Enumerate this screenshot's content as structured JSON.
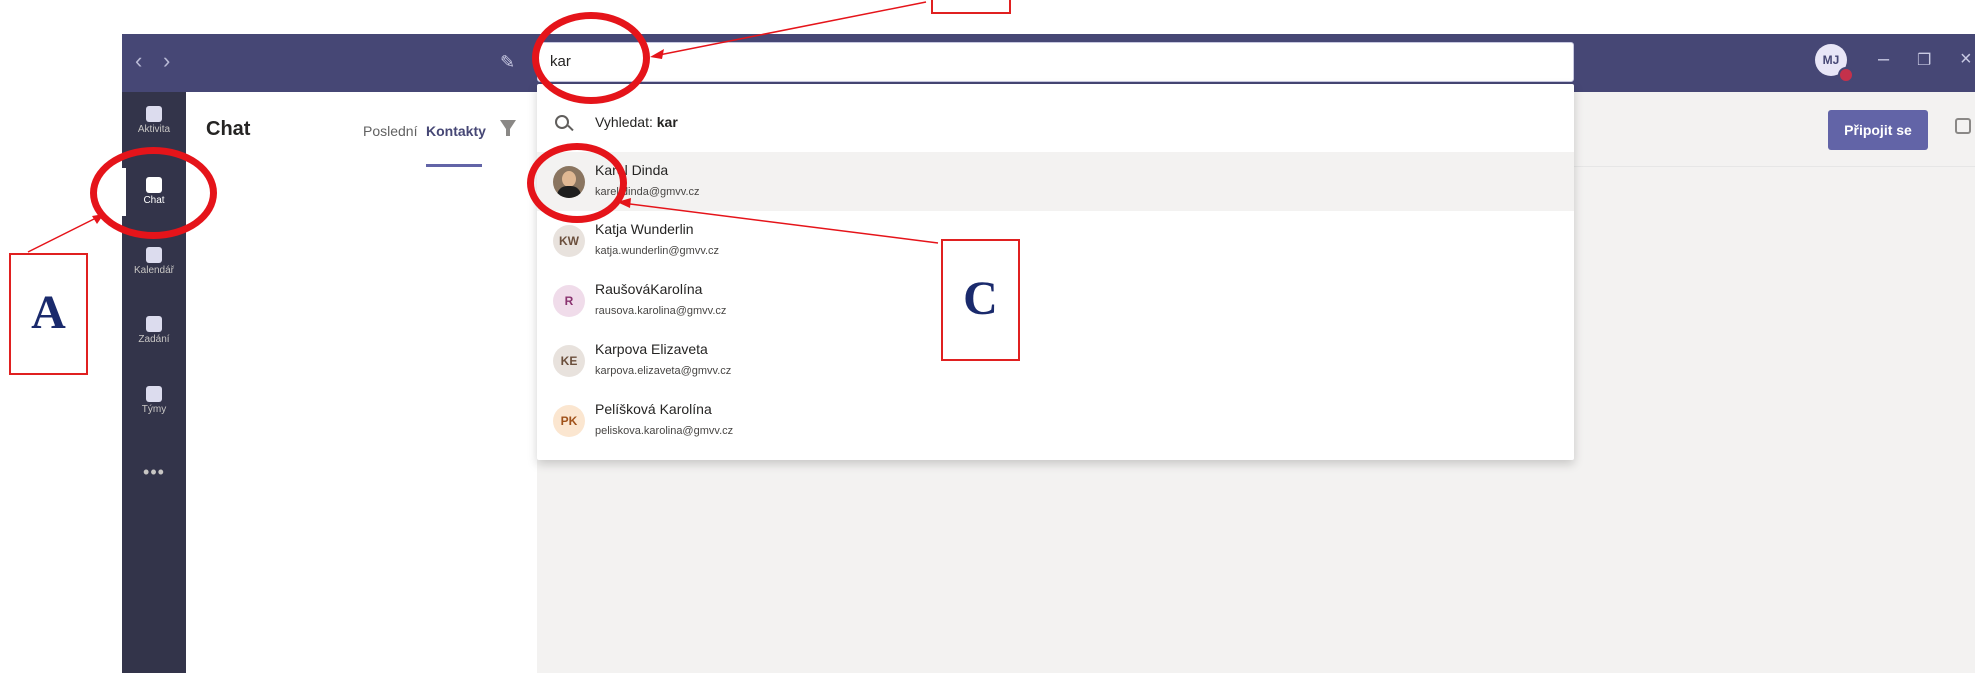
{
  "search": {
    "value": "kar"
  },
  "account": {
    "initials": "MJ"
  },
  "rail": {
    "items": [
      {
        "label": "Aktivita",
        "icon": "bell-icon"
      },
      {
        "label": "Chat",
        "icon": "chat-icon"
      },
      {
        "label": "Kalendář",
        "icon": "calendar-icon"
      },
      {
        "label": "Zadání",
        "icon": "assignments-icon"
      },
      {
        "label": "Týmy",
        "icon": "teams-icon"
      }
    ],
    "more": "•••"
  },
  "listpane": {
    "title": "Chat",
    "tabs": [
      {
        "label": "Poslední"
      },
      {
        "label": "Kontakty"
      }
    ]
  },
  "header": {
    "join_label": "Připojit se"
  },
  "dropdown": {
    "search_prefix": "Vyhledat: ",
    "search_term": "kar",
    "results": [
      {
        "name": "Karel Dinda",
        "email": "karel.dinda@gmvv.cz",
        "initials": "",
        "photo": true,
        "avatar_bg": "#8a7560",
        "avatar_fg": "#ffffff"
      },
      {
        "name": "Katja Wunderlin",
        "email": "katja.wunderlin@gmvv.cz",
        "initials": "KW",
        "avatar_bg": "#e8e2dd",
        "avatar_fg": "#6b4f3c"
      },
      {
        "name": "RaušováKarolína",
        "email": "rausova.karolina@gmvv.cz",
        "initials": "R",
        "avatar_bg": "#f0dcea",
        "avatar_fg": "#8a3370"
      },
      {
        "name": "Karpova Elizaveta",
        "email": "karpova.elizaveta@gmvv.cz",
        "initials": "KE",
        "avatar_bg": "#e8e2dd",
        "avatar_fg": "#6b4f3c"
      },
      {
        "name": "Pelíšková Karolína",
        "email": "peliskova.karolina@gmvv.cz",
        "initials": "PK",
        "avatar_bg": "#fbe6d0",
        "avatar_fg": "#a0521a"
      }
    ]
  },
  "annotations": {
    "a": "A",
    "c": "C"
  },
  "colors": {
    "titlebar": "#464775",
    "rail": "#33344a",
    "accent": "#6264a7",
    "annotation_red": "#e5141a"
  }
}
